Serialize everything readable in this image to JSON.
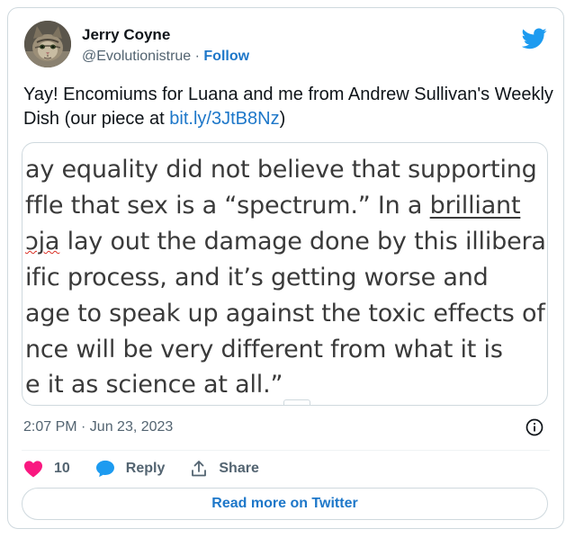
{
  "author": {
    "name": "Jerry Coyne",
    "handle": "@Evolutionistrue",
    "separator": " · ",
    "follow_label": "Follow"
  },
  "tweet": {
    "text_before_link": "Yay! Encomiums for Luana and me from Andrew Sullivan's Weekly Dish (our piece at ",
    "link_text": "bit.ly/3JtB8Nz",
    "text_after_link": ")"
  },
  "media": {
    "line1": "ay equality did not believe that supporting",
    "line2_a": "ffle that sex is a “spectrum.” In a ",
    "line2_link": "brilliant",
    "line3_a": "ɔja",
    "line3_b": " lay out the damage done by this illiberal",
    "line4": "ific process, and it’s getting worse and",
    "line5": "age to speak up against the toxic effects of",
    "line6": "nce will be very different from what it is",
    "line7": "e it as science at all.”"
  },
  "meta": {
    "timestamp": "2:07 PM · Jun 23, 2023"
  },
  "actions": {
    "like_count": "10",
    "reply_label": "Reply",
    "share_label": "Share"
  },
  "footer": {
    "read_more_label": "Read more on Twitter"
  },
  "colors": {
    "link": "#1d77c9",
    "twitter_blue": "#1d9bf0",
    "heart": "#f91880",
    "muted_text": "#536471",
    "border": "#cfd9de"
  },
  "icons": [
    "twitter-bird-icon",
    "info-icon",
    "heart-icon",
    "reply-bubble-icon",
    "share-icon"
  ]
}
